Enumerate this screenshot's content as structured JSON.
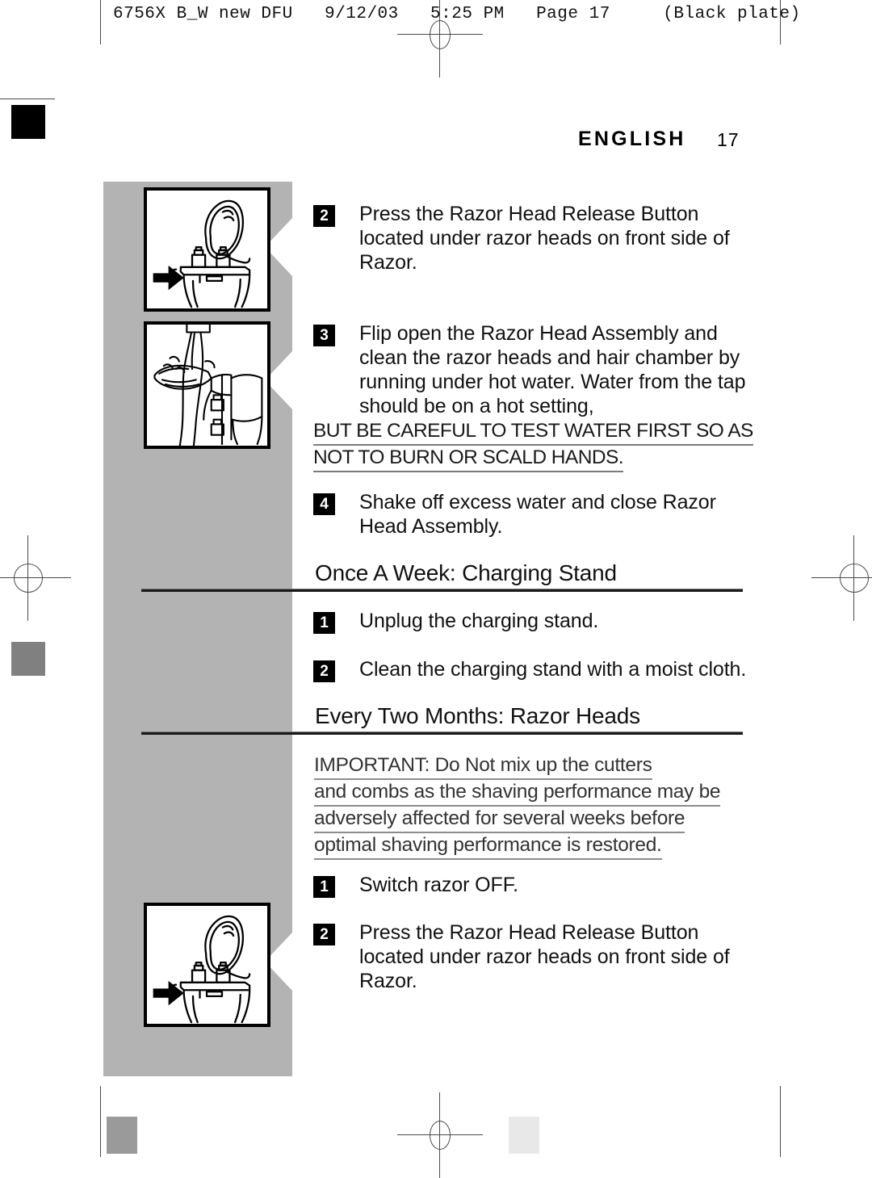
{
  "header": {
    "print_info": "6756X B_W new DFU   9/12/03   5:25 PM   Page 17     (Black plate)"
  },
  "page": {
    "language_title": "ENGLISH",
    "page_number": "17"
  },
  "steps_top": [
    {
      "number": "2",
      "text": "Press the Razor Head Release Button located under razor heads on front side of Razor."
    },
    {
      "number": "3",
      "text": "Flip open the Razor Head Assembly and clean the razor heads and hair chamber by running under hot water. Water from the tap should be on a hot setting,"
    }
  ],
  "caution": {
    "lines": [
      "BUT BE CAREFUL TO TEST WATER FIRST SO AS",
      "NOT TO BURN OR SCALD HANDS."
    ]
  },
  "step_four": {
    "number": "4",
    "text": "Shake off excess water and close Razor Head Assembly."
  },
  "section_once_a_week": {
    "heading": "Once A Week: Charging Stand",
    "steps": [
      {
        "number": "1",
        "text": "Unplug the charging stand."
      },
      {
        "number": "2",
        "text": "Clean the charging stand with a moist cloth."
      }
    ]
  },
  "section_every_two_months": {
    "heading": "Every Two Months: Razor Heads",
    "important_lines": [
      "IMPORTANT: Do Not mix up the cutters",
      "and combs as the shaving performance may be",
      "adversely affected for several weeks before",
      "optimal shaving performance is restored."
    ],
    "steps": [
      {
        "number": "1",
        "text": "Switch razor OFF."
      },
      {
        "number": "2",
        "text": "Press the Razor Head Release Button located under razor heads on front side of Razor."
      }
    ]
  },
  "illustrations": [
    {
      "name": "razor-head-release-button",
      "caption": "Razor with head assembly open and arrow pointing at release button"
    },
    {
      "name": "razor-rinse-under-water",
      "caption": "Razor head assembly rinsed under running water"
    },
    {
      "name": "razor-head-release-button-2",
      "caption": "Razor with head assembly open and arrow pointing at release button"
    }
  ],
  "print_marks": {
    "grayscale_wedge_dark": [
      "#000000",
      "#1c1c1c",
      "#333333",
      "#4d4d4d",
      "#666666",
      "#808080",
      "#9a9a9a"
    ],
    "grayscale_wedge_light": [
      "#b3b3b3",
      "#cccccc",
      "#e8e8e8"
    ],
    "swatch_black": "#000000",
    "swatch_gray": "#808080",
    "column_gray": "#b3b3b3"
  }
}
